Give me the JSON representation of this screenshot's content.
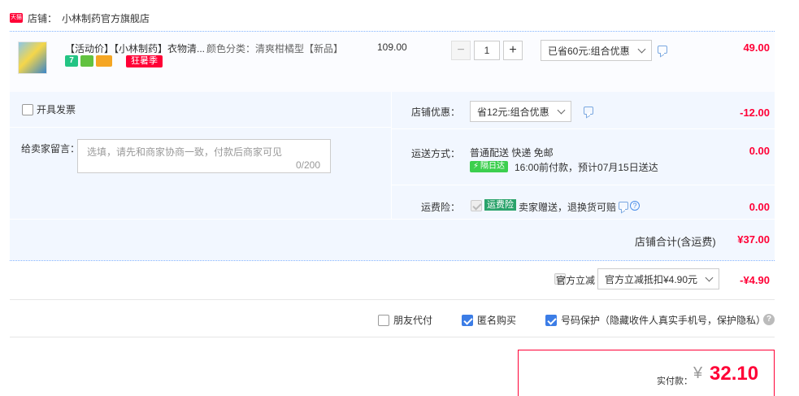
{
  "store": {
    "badge": "天猫",
    "label": "店铺：",
    "name": "小林制药官方旗舰店"
  },
  "item": {
    "title": "【活动价】【小林制药】衣物清...",
    "spec": "颜色分类：清爽柑橘型【新品】",
    "badge_7": "7",
    "promo_tag": "狂暑季",
    "unit_price": "109.00",
    "qty_minus": "−",
    "quantity": "1",
    "qty_plus": "+",
    "discount_select": "已省60元:组合优惠",
    "subtotal": "49.00"
  },
  "invoice": {
    "label": "开具发票",
    "checked": false
  },
  "message": {
    "label": "给卖家留言：",
    "placeholder": "选填，请先和商家协商一致，付款后商家可见",
    "counter": "0/200"
  },
  "store_discount": {
    "label": "店铺优惠：",
    "select": "省12元:组合优惠",
    "amount": "-12.00"
  },
  "shipping": {
    "label": "运送方式：",
    "method": "普通配送 快递 免邮",
    "badge": "隔日达",
    "note": "16:00前付款，预计07月15日送达",
    "fee": "0.00"
  },
  "insurance": {
    "label": "运费险：",
    "badge": "运费险",
    "text": "卖家赠送，退换货可赔",
    "help": "?",
    "fee": "0.00"
  },
  "store_total": {
    "label": "店铺合计(含运费)",
    "amount": "¥37.00"
  },
  "official_discount": {
    "label": "官方立减",
    "select": "官方立减抵扣¥4.90元",
    "amount": "-¥4.90"
  },
  "options": {
    "friend_pay": "朋友代付",
    "anonymous": "匿名购买",
    "number_protect": "号码保护（隐藏收件人真实手机号，保护隐私）",
    "help": "?"
  },
  "payment": {
    "label": "实付款：",
    "currency": "¥",
    "amount": "32.10"
  },
  "colors": {
    "accent_red": "#ff0036",
    "panel_blue": "#f2f7ff",
    "checkbox_blue": "#3c7de6"
  }
}
